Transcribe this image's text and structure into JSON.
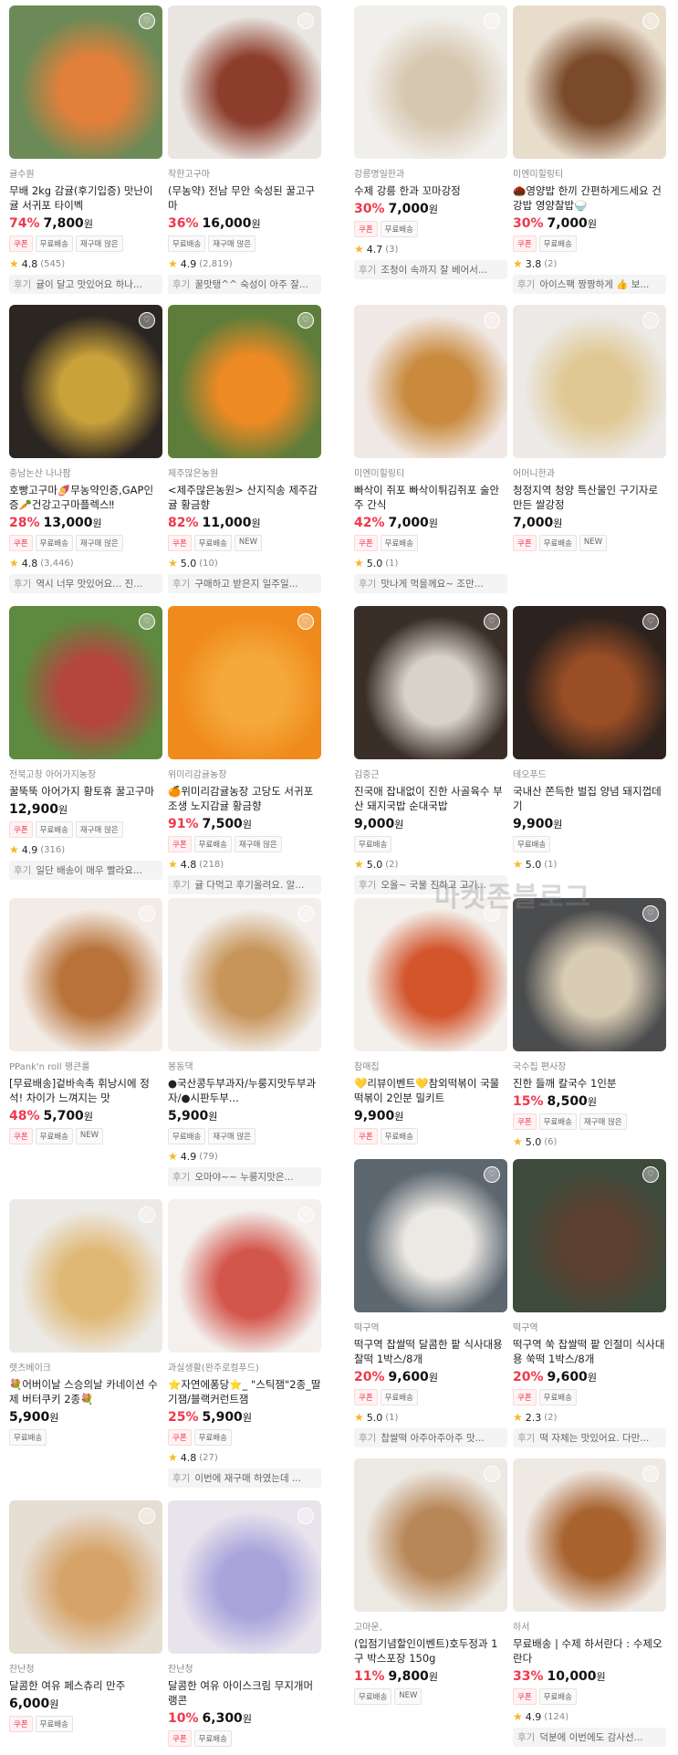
{
  "watermark": "마켓존블로그",
  "labels": {
    "coupon": "쿠폰",
    "free_shipping": "무료배송",
    "reorder": "재구매 많은",
    "new": "NEW",
    "review_prefix": "후기",
    "won": "원"
  },
  "products": [
    {
      "seller": "귤수원",
      "title": "무배 2kg 감귤(후기입증) 맛난이 귤 서귀포 타이벡",
      "discount": "74%",
      "price": "7,800",
      "tags": [
        "쿠폰",
        "무료배송",
        "재구매 많은"
      ],
      "rating": "4.8",
      "count": "(545)",
      "review": "귤이 달고 맛있어요 하나...",
      "colors": [
        "#6b8a57",
        "#e2803b"
      ]
    },
    {
      "seller": "착한고구마",
      "title": "(무농약) 전남 무안 숙성된 꿀고구마",
      "discount": "36%",
      "price": "16,000",
      "tags": [
        "무료배송",
        "재구매 많은"
      ],
      "rating": "4.9",
      "count": "(2,819)",
      "review": "꿀맛탱^^ 숙성이 아주 잘...",
      "colors": [
        "#e9e6e2",
        "#8d3d2c"
      ]
    },
    {
      "seller": "강릉명일한과",
      "title": "수제 강릉 한과 꼬마강정",
      "discount": "30%",
      "price": "7,000",
      "tags": [
        "쿠폰",
        "무료배송"
      ],
      "rating": "4.7",
      "count": "(3)",
      "review": "조청이 속까지 잘 베어서...",
      "colors": [
        "#f1efeb",
        "#d6c7b0"
      ]
    },
    {
      "seller": "미엔미힐링티",
      "title": "🌰영양밥 한끼 간편하게드세요 건강밥 영양찰밥🍚",
      "discount": "30%",
      "price": "7,000",
      "tags": [
        "쿠폰",
        "무료배송"
      ],
      "rating": "3.8",
      "count": "(2)",
      "review": "아이스팩 짱짱하게 👍 보...",
      "colors": [
        "#e8dccb",
        "#7a4a2a"
      ]
    },
    {
      "seller": "충남논산 나나팜",
      "title": "호빵고구마🍠무농약인증,GAP인증🥕건강고구마플렉스‼",
      "discount": "28%",
      "price": "13,000",
      "tags": [
        "쿠폰",
        "무료배송",
        "재구매 많은"
      ],
      "rating": "4.8",
      "count": "(3,446)",
      "review": "역시 너무 맛있어요... 진...",
      "colors": [
        "#2c2622",
        "#c9a23a"
      ]
    },
    {
      "seller": "제주많은농원",
      "title": "<제주많은농원> 산지직송 제주감귤 황금향",
      "discount": "82%",
      "price": "11,000",
      "tags": [
        "쿠폰",
        "무료배송",
        "NEW"
      ],
      "rating": "5.0",
      "count": "(10)",
      "review": "구매하고 받은지 일주일...",
      "colors": [
        "#5f7d3a",
        "#ee8a24"
      ]
    },
    {
      "seller": "미엔미힐링티",
      "title": "빠삭이 쥐포 빠삭이튀김쥐포 술안주 간식",
      "discount": "42%",
      "price": "7,000",
      "tags": [
        "쿠폰",
        "무료배송"
      ],
      "rating": "5.0",
      "count": "(1)",
      "review": "맛나게 먹을께요~ 조만...",
      "colors": [
        "#f0e8e4",
        "#c98a3e"
      ]
    },
    {
      "seller": "어머니한과",
      "title": "청정지역 청양 특산물인 구기자로 만든 쌀강정",
      "discount": "",
      "price": "7,000",
      "tags": [
        "쿠폰",
        "무료배송",
        "NEW"
      ],
      "rating": "",
      "count": "",
      "review": "",
      "colors": [
        "#ece9e6",
        "#dfc893"
      ]
    },
    {
      "seller": "전북고창 아어가지농장",
      "title": "꿀뚝뚝 아어가지 황토휴 꿀고구마",
      "discount": "",
      "price": "12,900",
      "tags": [
        "쿠폰",
        "무료배송",
        "재구매 많은"
      ],
      "rating": "4.9",
      "count": "(316)",
      "review": "일단 배송이 매우 빨라요...",
      "colors": [
        "#5d8a3f",
        "#b4463f"
      ]
    },
    {
      "seller": "위미리감귤농장",
      "title": "🍊위미리감귤농장 고당도 서귀포 조생 노지감귤 황금향",
      "discount": "91%",
      "price": "7,500",
      "tags": [
        "쿠폰",
        "무료배송",
        "재구매 많은"
      ],
      "rating": "4.8",
      "count": "(218)",
      "review": "귤 다먹고 후기올려요. 알...",
      "colors": [
        "#f08a1c",
        "#f5a93b"
      ]
    },
    {
      "seller": "PPank'n roll 팽큰롤",
      "title": "[무료배송]겉바속촉 휘낭시에 정석! 차이가 느껴지는 맛",
      "discount": "48%",
      "price": "5,700",
      "tags": [
        "쿠폰",
        "무료배송",
        "NEW"
      ],
      "rating": "",
      "count": "",
      "review": "",
      "colors": [
        "#f3ece6",
        "#b9733a"
      ]
    },
    {
      "seller": "봉동댁",
      "title": "●국산콩두부과자/누룽지맛두부과자/●시판두부...",
      "discount": "",
      "price": "5,900",
      "tags": [
        "무료배송",
        "재구매 많은"
      ],
      "rating": "4.9",
      "count": "(79)",
      "review": "오마야~~ 누룽지맛은...",
      "colors": [
        "#f2efec",
        "#c7955a"
      ]
    },
    {
      "seller": "렛츠베이크",
      "title": "💐어버이날 스승의날 카네이션 수제 버터쿠키 2종💐",
      "discount": "",
      "price": "5,900",
      "tags": [
        "무료배송"
      ],
      "rating": "",
      "count": "",
      "review": "",
      "colors": [
        "#eceae6",
        "#e0b875"
      ]
    },
    {
      "seller": "과실생활(완주로컬푸드)",
      "title": "⭐자연에퐁당⭐_ \"스틱잼\"2종_딸기잼/블랙커런트잼",
      "discount": "25%",
      "price": "5,900",
      "tags": [
        "쿠폰",
        "무료배송"
      ],
      "rating": "4.8",
      "count": "(27)",
      "review": "이번에 재구매 하였는데 ...",
      "colors": [
        "#f3f0ee",
        "#d3564c"
      ]
    },
    {
      "seller": "잔난청",
      "title": "달콤한 여유 페스츄리 만주",
      "discount": "",
      "price": "6,000",
      "tags": [
        "쿠폰",
        "무료배송"
      ],
      "rating": "",
      "count": "",
      "review": "",
      "colors": [
        "#e6ddd3",
        "#d6a46a"
      ]
    },
    {
      "seller": "잔난청",
      "title": "달콤한 여유 아이스크림 무지개머랭콘",
      "discount": "10%",
      "price": "6,300",
      "tags": [
        "쿠폰",
        "무료배송"
      ],
      "rating": "",
      "count": "",
      "review": "",
      "colors": [
        "#e9e4ec",
        "#a9a4dc"
      ]
    },
    {
      "seller": "김중근",
      "title": "진국애 잡내없이 진한 사골육수 부산 돼지국밥 순대국밥",
      "discount": "",
      "price": "9,000",
      "tags": [
        "무료배송"
      ],
      "rating": "5.0",
      "count": "(2)",
      "review": "오올~ 국물 진하고 고기...",
      "colors": [
        "#3a2f28",
        "#d8d2c8"
      ]
    },
    {
      "seller": "테오푸드",
      "title": "국내산 쫀득한 벌집 양념 돼지껍데기",
      "discount": "",
      "price": "9,900",
      "tags": [
        "무료배송"
      ],
      "rating": "5.0",
      "count": "(1)",
      "review": "",
      "colors": [
        "#2d221d",
        "#9a4e26"
      ]
    },
    {
      "seller": "참매집",
      "title": "💛리뷰이벤트💛참외떡볶이 국물떡볶이 2인분 밀키트",
      "discount": "",
      "price": "9,900",
      "tags": [
        "쿠폰",
        "무료배송"
      ],
      "rating": "",
      "count": "",
      "review": "",
      "colors": [
        "#f3f0ec",
        "#d2552c"
      ]
    },
    {
      "seller": "국수집 편사장",
      "title": "진한 들깨 칼국수 1인분",
      "discount": "15%",
      "price": "8,500",
      "tags": [
        "쿠폰",
        "무료배송",
        "재구매 많은"
      ],
      "rating": "5.0",
      "count": "(6)",
      "review": "",
      "colors": [
        "#4b4c4e",
        "#d9ccb4"
      ]
    },
    {
      "seller": "떡구역",
      "title": "떡구역 찹쌀떡 달콤한 팥 식사대용 찰떡 1박스/8개",
      "discount": "20%",
      "price": "9,600",
      "tags": [
        "쿠폰",
        "무료배송"
      ],
      "rating": "5.0",
      "count": "(1)",
      "review": "찹쌀떡 아주아주아주 맛...",
      "colors": [
        "#5c6770",
        "#ece9e4"
      ]
    },
    {
      "seller": "떡구역",
      "title": "떡구역 쑥 찹쌀떡 팥 인절미 식사대용 쑥떡 1박스/8개",
      "discount": "20%",
      "price": "9,600",
      "tags": [
        "쿠폰",
        "무료배송"
      ],
      "rating": "2.3",
      "count": "(2)",
      "review": "떡 자체는 맛있어요. 다만...",
      "colors": [
        "#3e4a3b",
        "#5c4030"
      ]
    },
    {
      "seller": "고마운,",
      "title": "(입점기념할인이벤트)호두정과 1구 박스포장 150g",
      "discount": "11%",
      "price": "9,800",
      "tags": [
        "무료배송",
        "NEW"
      ],
      "rating": "",
      "count": "",
      "review": "",
      "colors": [
        "#ece8e2",
        "#b88758"
      ]
    },
    {
      "seller": "하서",
      "title": "무료배송 | 수제 하서란다 : 수제오란다",
      "discount": "33%",
      "price": "10,000",
      "tags": [
        "쿠폰",
        "무료배송"
      ],
      "rating": "4.9",
      "count": "(124)",
      "review": "덕분에 이번에도 감사선...",
      "colors": [
        "#efe9e4",
        "#a8632f"
      ]
    }
  ]
}
